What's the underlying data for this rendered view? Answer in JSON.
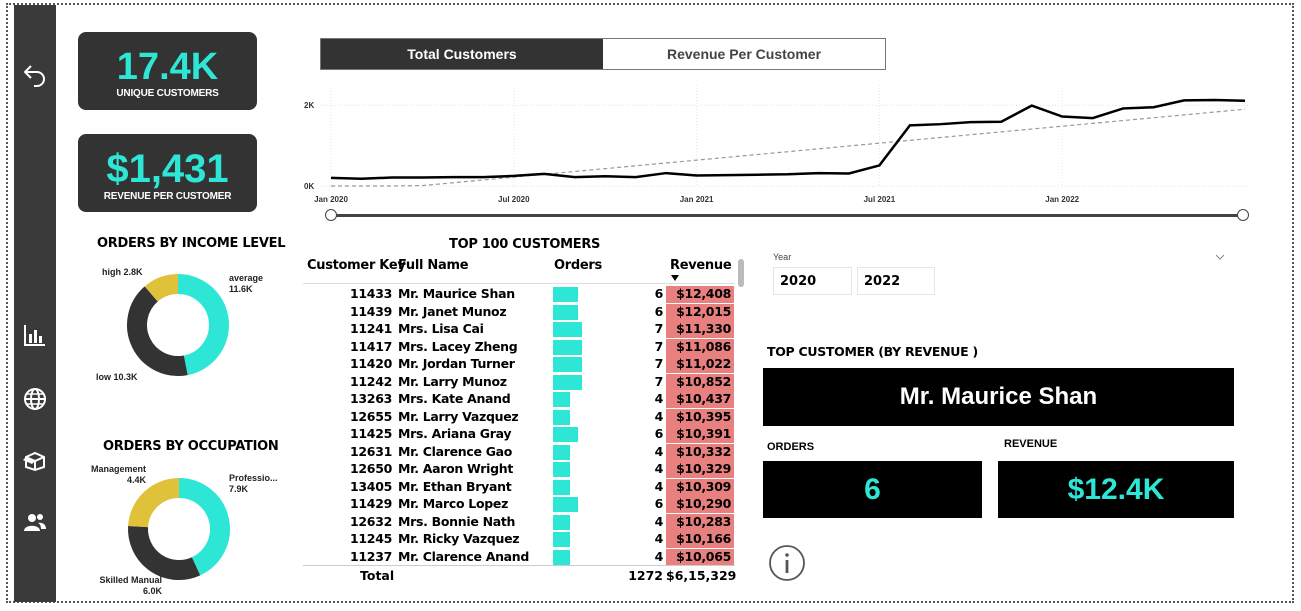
{
  "nav": {
    "icons": [
      "back-arrow-icon",
      "bar-chart-icon",
      "globe-icon",
      "box-icon",
      "users-icon"
    ]
  },
  "kpis": {
    "unique_customers": {
      "value": "17.4K",
      "label": "UNIQUE CUSTOMERS"
    },
    "revenue_per_customer": {
      "value": "$1,431",
      "label": "REVENUE PER CUSTOMER"
    }
  },
  "income": {
    "title": "ORDERS BY INCOME LEVEL",
    "segments": [
      {
        "label": "average",
        "value": "11.6K",
        "num": 11.6,
        "color": "#2ee6d6"
      },
      {
        "label": "low",
        "value": "10.3K",
        "num": 10.3,
        "color": "#333333"
      },
      {
        "label": "high",
        "value": "2.8K",
        "num": 2.8,
        "color": "#e0c23a"
      }
    ]
  },
  "occupation": {
    "title": "ORDERS BY OCCUPATION",
    "segments": [
      {
        "label": "Professio...",
        "value": "7.9K",
        "num": 7.9,
        "color": "#2ee6d6"
      },
      {
        "label": "Skilled Manual",
        "value": "6.0K",
        "num": 6.0,
        "color": "#333333"
      },
      {
        "label": "Management",
        "value": "4.4K",
        "num": 4.4,
        "color": "#e0c23a"
      }
    ]
  },
  "tabs": [
    {
      "label": "Total Customers",
      "active": true
    },
    {
      "label": "Revenue Per Customer",
      "active": false
    }
  ],
  "chart_data": {
    "type": "line",
    "x_ticks": [
      "Jan 2020",
      "Jul 2020",
      "Jan 2021",
      "Jul 2021",
      "Jan 2022"
    ],
    "y_ticks": [
      "0K",
      "2K"
    ],
    "ylim": [
      0,
      2500
    ],
    "x": [
      "2020-01",
      "2020-02",
      "2020-03",
      "2020-04",
      "2020-05",
      "2020-06",
      "2020-07",
      "2020-08",
      "2020-09",
      "2020-10",
      "2020-11",
      "2020-12",
      "2021-01",
      "2021-02",
      "2021-03",
      "2021-04",
      "2021-05",
      "2021-06",
      "2021-07",
      "2021-08",
      "2021-09",
      "2021-10",
      "2021-11",
      "2021-12",
      "2022-01",
      "2022-02",
      "2022-03",
      "2022-04",
      "2022-05",
      "2022-06",
      "2022-07"
    ],
    "series": [
      {
        "values": [
          200,
          180,
          210,
          210,
          220,
          220,
          250,
          300,
          220,
          240,
          220,
          320,
          260,
          270,
          280,
          290,
          320,
          310,
          510,
          1500,
          1530,
          1580,
          1590,
          1990,
          1720,
          1680,
          1920,
          1950,
          2120,
          2130,
          2110
        ]
      },
      {
        "values": [
          -200,
          -130,
          -60,
          10,
          80,
          150,
          220,
          290,
          360,
          430,
          500,
          570,
          640,
          710,
          780,
          850,
          920,
          990,
          1060,
          1130,
          1200,
          1270,
          1340,
          1410,
          1480,
          1550,
          1620,
          1690,
          1760,
          1830,
          1900
        ]
      }
    ],
    "grid": true
  },
  "table": {
    "title": "TOP 100 CUSTOMERS",
    "headers": {
      "key": "Customer Key",
      "name": "Full Name",
      "orders": "Orders",
      "revenue": "Revenue"
    },
    "rows": [
      {
        "key": "11433",
        "name": "Mr. Maurice Shan",
        "orders": "6",
        "revenue": "$12,408"
      },
      {
        "key": "11439",
        "name": "Mr. Janet Munoz",
        "orders": "6",
        "revenue": "$12,015"
      },
      {
        "key": "11241",
        "name": "Mrs. Lisa Cai",
        "orders": "7",
        "revenue": "$11,330"
      },
      {
        "key": "11417",
        "name": "Mrs. Lacey Zheng",
        "orders": "7",
        "revenue": "$11,086"
      },
      {
        "key": "11420",
        "name": "Mr. Jordan Turner",
        "orders": "7",
        "revenue": "$11,022"
      },
      {
        "key": "11242",
        "name": "Mr. Larry Munoz",
        "orders": "7",
        "revenue": "$10,852"
      },
      {
        "key": "13263",
        "name": "Mrs. Kate Anand",
        "orders": "4",
        "revenue": "$10,437"
      },
      {
        "key": "12655",
        "name": "Mr. Larry Vazquez",
        "orders": "4",
        "revenue": "$10,395"
      },
      {
        "key": "11425",
        "name": "Mrs. Ariana Gray",
        "orders": "6",
        "revenue": "$10,391"
      },
      {
        "key": "12631",
        "name": "Mr. Clarence Gao",
        "orders": "4",
        "revenue": "$10,332"
      },
      {
        "key": "12650",
        "name": "Mr. Aaron Wright",
        "orders": "4",
        "revenue": "$10,329"
      },
      {
        "key": "13405",
        "name": "Mr. Ethan Bryant",
        "orders": "4",
        "revenue": "$10,309"
      },
      {
        "key": "11429",
        "name": "Mr. Marco Lopez",
        "orders": "6",
        "revenue": "$10,290"
      },
      {
        "key": "12632",
        "name": "Mrs. Bonnie Nath",
        "orders": "4",
        "revenue": "$10,283"
      },
      {
        "key": "11245",
        "name": "Mr. Ricky Vazquez",
        "orders": "4",
        "revenue": "$10,166"
      },
      {
        "key": "11237",
        "name": "Mr. Clarence Anand",
        "orders": "4",
        "revenue": "$10,065"
      }
    ],
    "total": {
      "label": "Total",
      "orders": "1272",
      "revenue": "$6,15,329"
    }
  },
  "year_slicer": {
    "label": "Year",
    "from": "2020",
    "to": "2022"
  },
  "top_customer": {
    "title": "TOP CUSTOMER (BY REVENUE )",
    "name": "Mr. Maurice Shan",
    "orders_label": "ORDERS",
    "orders_value": "6",
    "revenue_label": "REVENUE",
    "revenue_value": "$12.4K"
  },
  "colors": {
    "accent": "#2ee6d6",
    "dark": "#333333",
    "revenue_highlight": "#e88080",
    "yellow": "#e0c23a"
  }
}
